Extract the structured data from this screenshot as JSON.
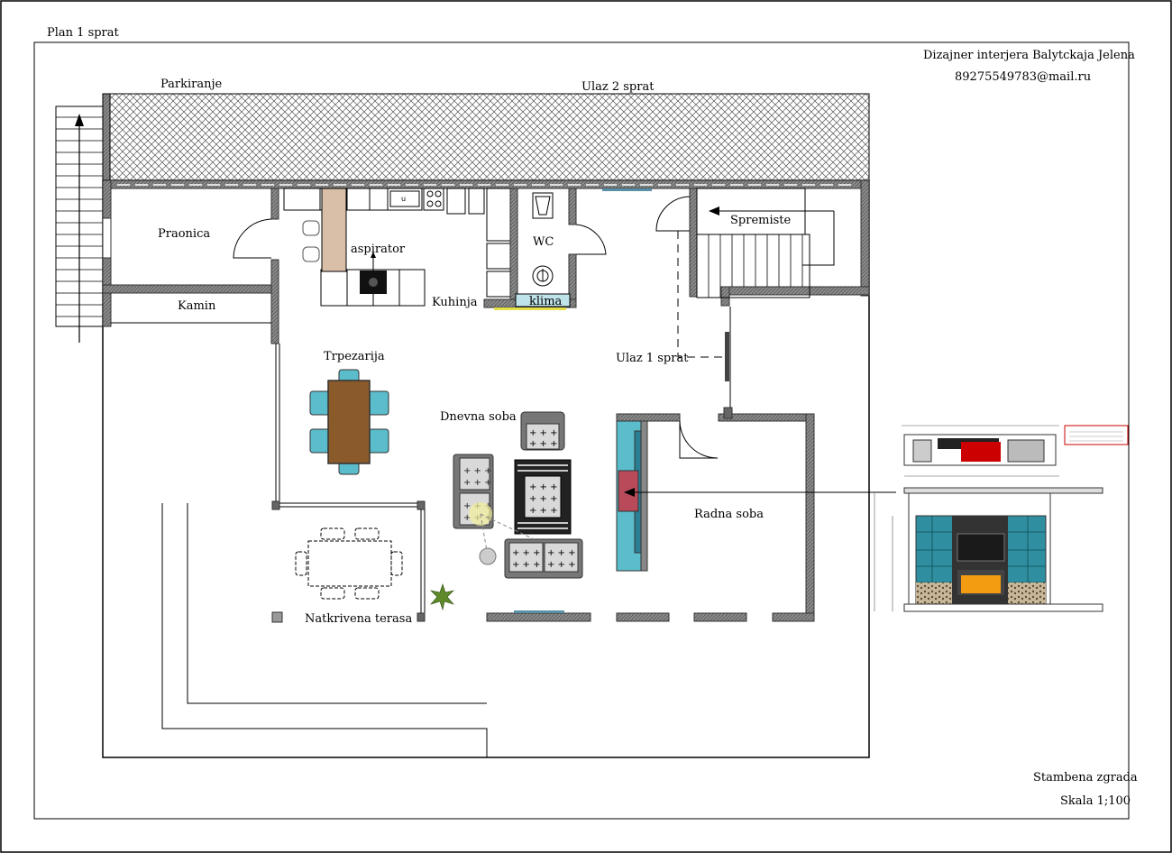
{
  "sheet": {
    "plan_title": "Plan 1 sprat",
    "designer": "Dizajner interjera Balytckaja Jelena",
    "email": "89275549783@mail.ru",
    "building": "Stambena zgrada",
    "scale": "Skala 1;100"
  },
  "rooms": {
    "parking": "Parkiranje",
    "entrance_2": "Ulaz 2 sprat",
    "laundry": "Praonica",
    "fireplace": "Kamin",
    "hood": "aspirator",
    "kitchen": "Kuhinja",
    "wc": "WC",
    "climate": "klima",
    "storage": "Spremiste",
    "entrance_1": "Ulaz 1 sprat",
    "dining": "Trpezarija",
    "living": "Dnevna soba",
    "study": "Radna soba",
    "terrace": "Natkrivena terasa"
  },
  "colors": {
    "wall": "#7a7a7a",
    "chair": "#5bbccb",
    "dining_table": "#8b5a2b",
    "fireplace_tile": "#2f8fa0",
    "fireplace_fire": "#f39c12",
    "hood": "#d9bfa8",
    "note_red": "#cc0000"
  }
}
